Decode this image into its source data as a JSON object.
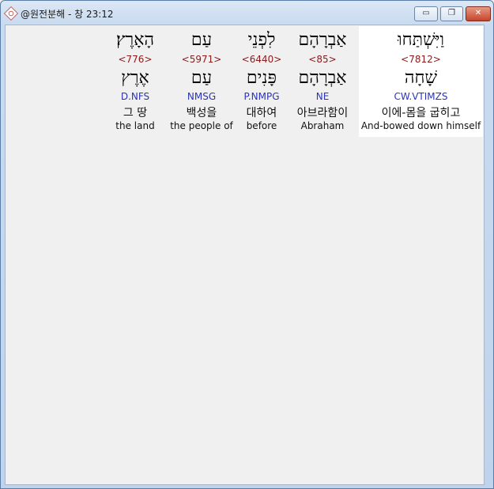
{
  "window": {
    "title": "@원전분해 - 창 23:12",
    "controls": {
      "minimize": "▭",
      "maximize": "❐",
      "close": "✕"
    }
  },
  "words": [
    {
      "hebrew": "הָאָרֶץ׃",
      "strong": "<776>",
      "root": "אֶרֶץ",
      "parsing": "D.NFS",
      "korean": "그 땅",
      "english": "the land"
    },
    {
      "hebrew": "עַם",
      "strong": "<5971>",
      "root": "עַם",
      "parsing": "NMSG",
      "korean": "백성을",
      "english": "the people of"
    },
    {
      "hebrew": "לִפְנֵי",
      "strong": "<6440>",
      "root": "פָּנִים",
      "parsing": "P.NMPG",
      "korean": "대하여",
      "english": "before"
    },
    {
      "hebrew": "אַבְרָהָם",
      "strong": "<85>",
      "root": "אַבְרָהָם",
      "parsing": "NE",
      "korean": "아브라함이",
      "english": "Abraham"
    },
    {
      "hebrew": "וַיִּשְׁתַּחוּ",
      "strong": "<7812>",
      "root": "שָׁחָה",
      "parsing": "CW.VTIMZS",
      "korean": "이에-몸을 굽히고",
      "english": "And-bowed down himself",
      "selected": true
    }
  ]
}
